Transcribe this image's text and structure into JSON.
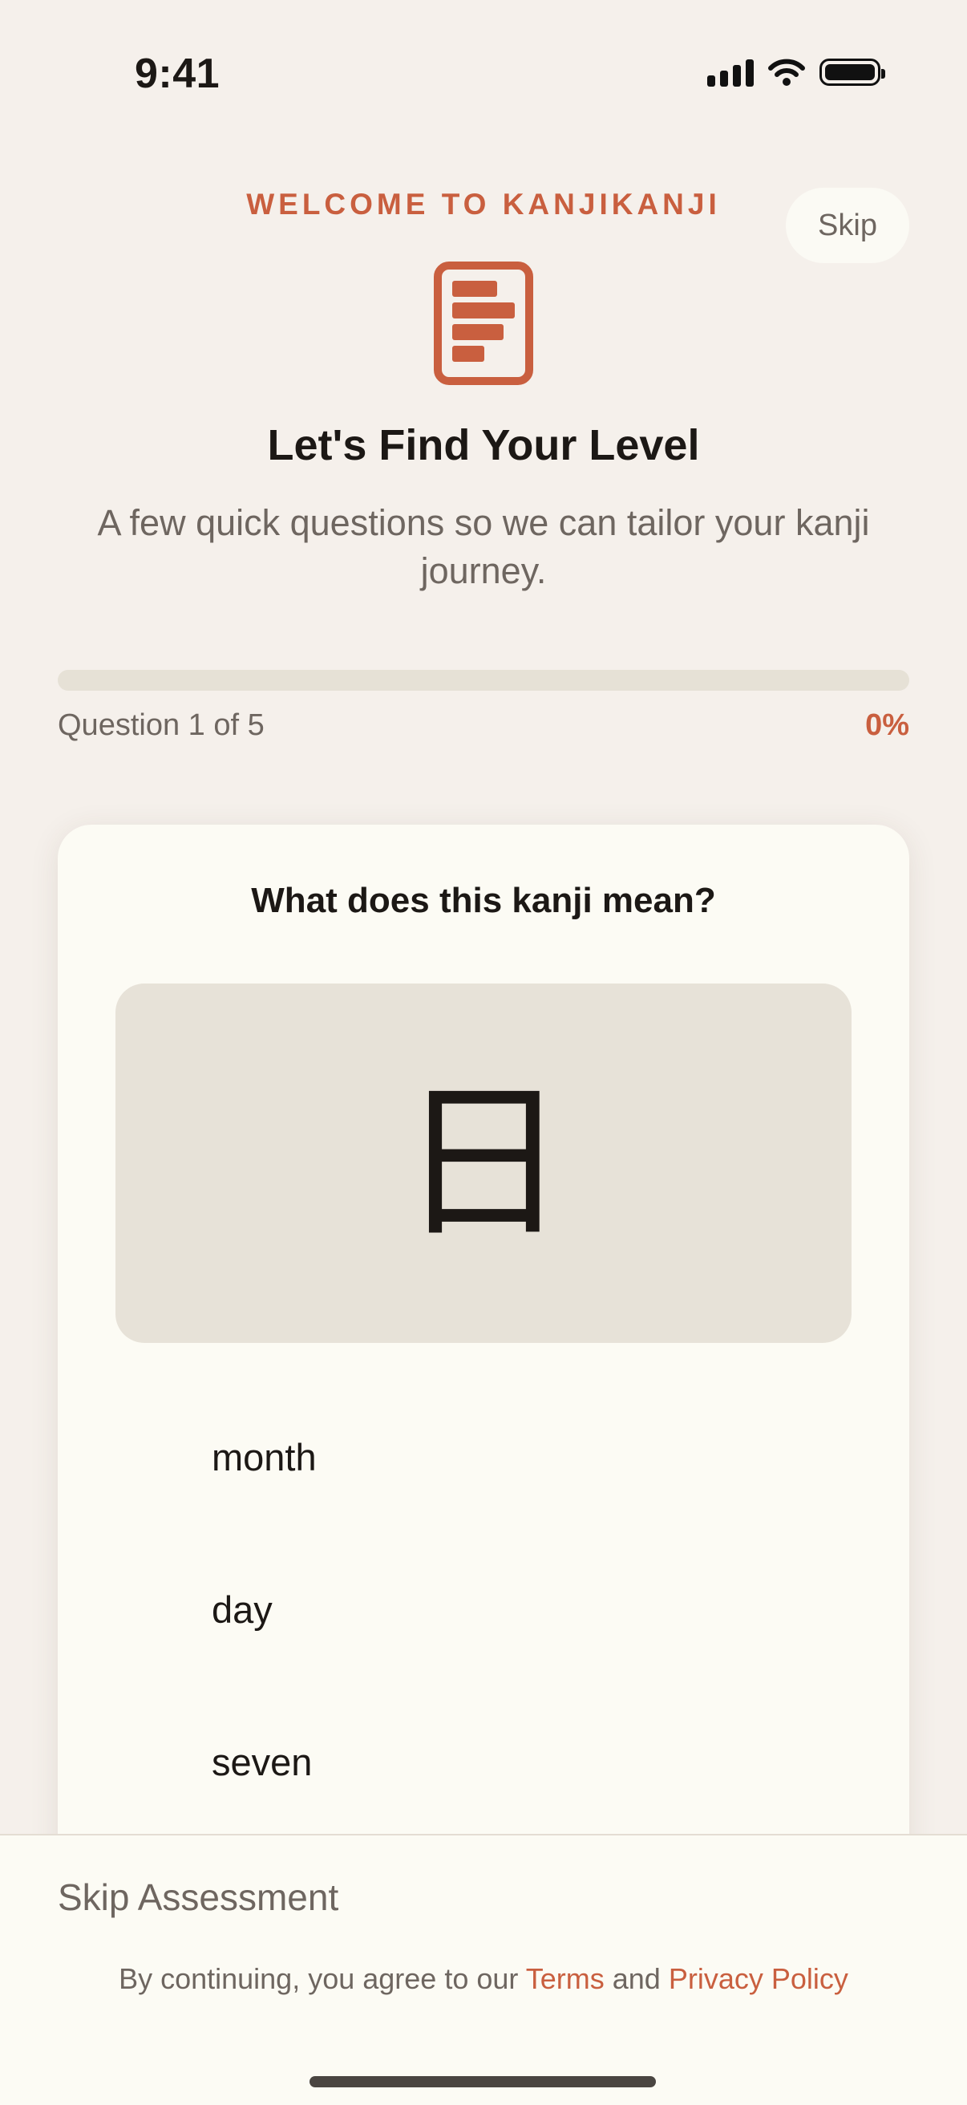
{
  "status_bar": {
    "time": "9:41"
  },
  "header": {
    "welcome_text": "WELCOME TO KANJIKANJI",
    "skip_label": "Skip",
    "title": "Let's Find Your Level",
    "subtitle": "A few quick questions so we can tailor your kanji journey."
  },
  "progress": {
    "question_label": "Question 1 of 5",
    "percent_label": "0%",
    "fraction": 0
  },
  "question_card": {
    "prompt": "What does this kanji mean?",
    "kanji": "日",
    "options": [
      {
        "label": "month"
      },
      {
        "label": "day"
      },
      {
        "label": "seven"
      }
    ]
  },
  "footer": {
    "skip_assessment_label": "Skip Assessment",
    "legal_prefix": "By continuing, you agree to our",
    "terms_label": "Terms",
    "and_label": "and",
    "privacy_label": "Privacy Policy"
  },
  "colors": {
    "accent": "#c95f3f",
    "background": "#f5f0eb",
    "card": "#fcfbf4",
    "kanji_panel": "#e7e2d8"
  },
  "icons": [
    "signal-icon",
    "wifi-icon",
    "battery-icon",
    "level-assessment-icon"
  ]
}
